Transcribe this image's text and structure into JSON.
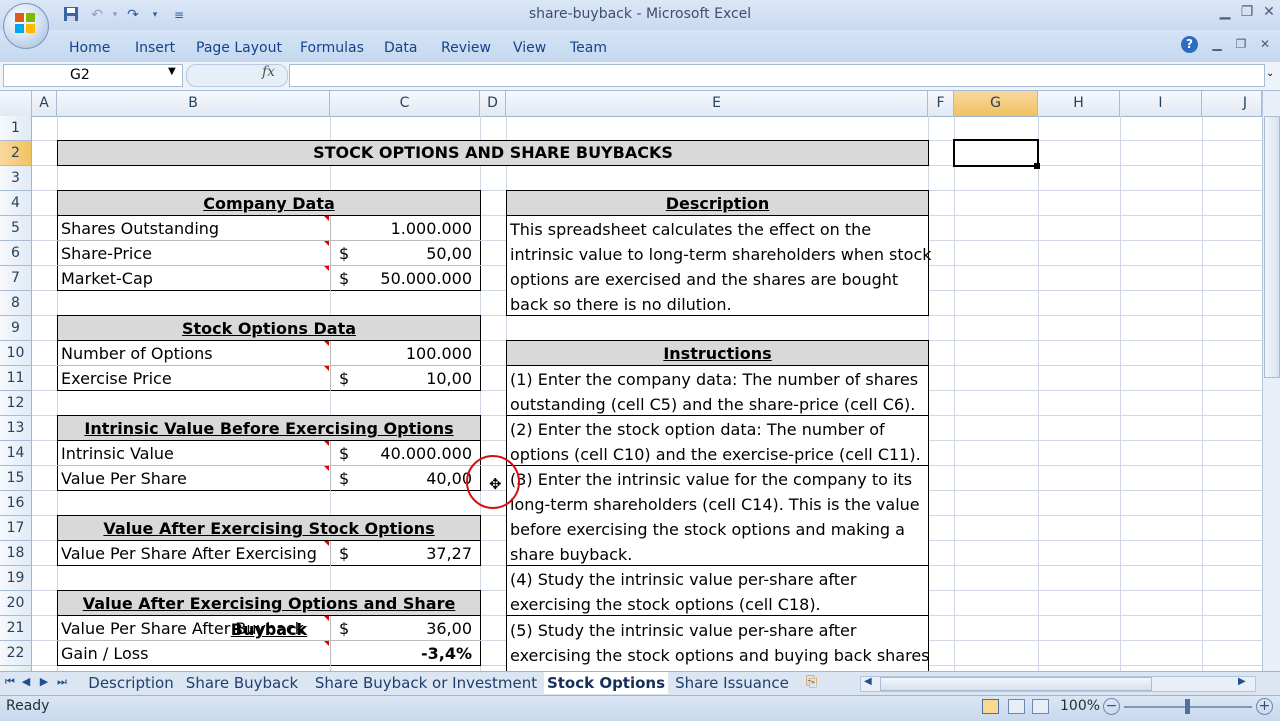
{
  "window": {
    "title": "share-buyback - Microsoft Excel"
  },
  "ribbon_tabs": [
    "Home",
    "Insert",
    "Page Layout",
    "Formulas",
    "Data",
    "Review",
    "View",
    "Team"
  ],
  "name_box": {
    "value": "G2"
  },
  "formula_bar": {
    "fx_label": "fx",
    "value": ""
  },
  "columns": [
    "A",
    "B",
    "C",
    "D",
    "E",
    "F",
    "G",
    "H",
    "I",
    "J"
  ],
  "rows": [
    "1",
    "2",
    "3",
    "4",
    "5",
    "6",
    "7",
    "8",
    "9",
    "10",
    "11",
    "12",
    "13",
    "14",
    "15",
    "16",
    "17",
    "18",
    "19",
    "20",
    "21",
    "22"
  ],
  "sheet": {
    "title": "STOCK OPTIONS AND SHARE BUYBACKS",
    "company": {
      "header": "Company Data",
      "rows": [
        {
          "label": "Shares Outstanding",
          "currency": "",
          "value": "1.000.000"
        },
        {
          "label": "Share-Price",
          "currency": "$",
          "value": "50,00"
        },
        {
          "label": "Market-Cap",
          "currency": "$",
          "value": "50.000.000"
        }
      ]
    },
    "options": {
      "header": "Stock Options Data",
      "rows": [
        {
          "label": "Number of Options",
          "currency": "",
          "value": "100.000"
        },
        {
          "label": "Exercise Price",
          "currency": "$",
          "value": "10,00"
        }
      ]
    },
    "before": {
      "header": "Intrinsic Value Before Exercising Options",
      "rows": [
        {
          "label": "Intrinsic Value",
          "currency": "$",
          "value": "40.000.000"
        },
        {
          "label": "Value Per Share",
          "currency": "$",
          "value": "40,00"
        }
      ]
    },
    "after_exercise": {
      "header": "Value After Exercising Stock Options",
      "rows": [
        {
          "label": "Value Per Share After Exercising",
          "currency": "$",
          "value": "37,27"
        }
      ]
    },
    "after_buyback": {
      "header": "Value After Exercising Options and Share Buyback",
      "rows": [
        {
          "label": "Value Per Share After Buyback",
          "currency": "$",
          "value": "36,00"
        },
        {
          "label": "Gain / Loss",
          "currency": "",
          "value": "-3,4%"
        }
      ]
    },
    "description": {
      "header": "Description",
      "lines": [
        "This spreadsheet calculates the effect on the",
        "intrinsic value to long-term shareholders when stock",
        "options are exercised and the shares are bought",
        "back so there is no dilution."
      ]
    },
    "instructions": {
      "header": "Instructions",
      "lines": [
        "(1) Enter the company data: The number of shares",
        "outstanding (cell C5) and the share-price (cell C6).",
        "(2) Enter the stock option data: The number of",
        "options (cell C10) and the exercise-price (cell C11).",
        "(3) Enter the intrinsic value for the company to its",
        "long-term shareholders (cell C14). This is the value",
        "before exercising the stock options and making a",
        "share buyback.",
        "(4) Study the intrinsic value per-share after",
        "exercising the stock options (cell C18).",
        "(5) Study the intrinsic value per-share after",
        "exercising the stock options and buying back shares"
      ]
    }
  },
  "sheet_tabs": [
    {
      "label": "Description",
      "active": false
    },
    {
      "label": "Share Buyback",
      "active": false
    },
    {
      "label": "Share Buyback or Investment",
      "active": false
    },
    {
      "label": "Stock Options",
      "active": true
    },
    {
      "label": "Share Issuance",
      "active": false
    }
  ],
  "status": {
    "text": "Ready",
    "zoom": "100%"
  }
}
